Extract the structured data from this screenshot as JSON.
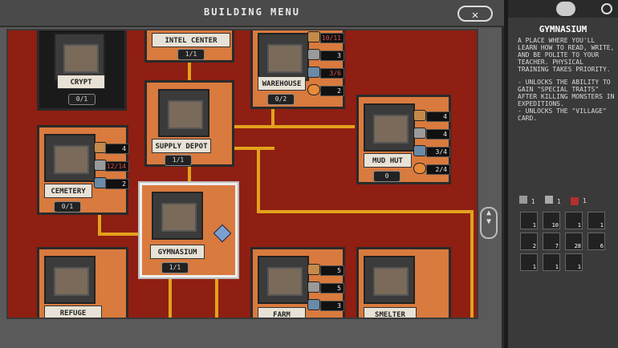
{
  "window": {
    "title": "BUILDING MENU",
    "close_label": "✕"
  },
  "cards": {
    "intel": {
      "label": "INTEL CENTER",
      "count": "1/1"
    },
    "crypt": {
      "label": "CRYPT",
      "count": "0/1"
    },
    "warehouse": {
      "label": "WAREHOUSE",
      "count": "0/2",
      "stats": [
        "10/11",
        "3",
        "3/6",
        "2"
      ]
    },
    "supply": {
      "label": "SUPPLY DEPOT",
      "count": "1/1"
    },
    "cemetery": {
      "label": "CEMETERY",
      "count": "0/1",
      "stats": [
        "4",
        "12/14",
        "2"
      ]
    },
    "mudhut": {
      "label": "MUD HUT",
      "count": "0",
      "stats": [
        "4",
        "4",
        "3/4",
        "2/4"
      ]
    },
    "gym": {
      "label": "GYMNASIUM",
      "count": "1/1"
    },
    "refuge": {
      "label": "REFUGE"
    },
    "farm": {
      "label": "FARM",
      "stats": [
        "5",
        "5",
        "3"
      ]
    },
    "smelter": {
      "label": "SMELTER"
    }
  },
  "panel": {
    "title": "GYMNASIUM",
    "desc": "A PLACE WHERE YOU'LL LEARN HOW TO READ, WRITE, AND BE POLITE TO YOUR TEACHER. PHYSICAL TRAINING TAKES PRIORITY.",
    "bullet1": "- UNLOCKS THE ABILITY TO GAIN \"SPECIAL TRAITS\" AFTER KILLING MONSTERS IN EXPEDITIONS.",
    "bullet2": "- UNLOCKS THE \"VILLAGE\" CARD.",
    "tags": [
      "1",
      "1",
      "1"
    ],
    "inventory": [
      "1",
      "10",
      "1",
      "1",
      "2",
      "7",
      "28",
      "6",
      "1",
      "1",
      "1"
    ]
  },
  "scroll": {
    "up": "▲",
    "down": "▼"
  }
}
